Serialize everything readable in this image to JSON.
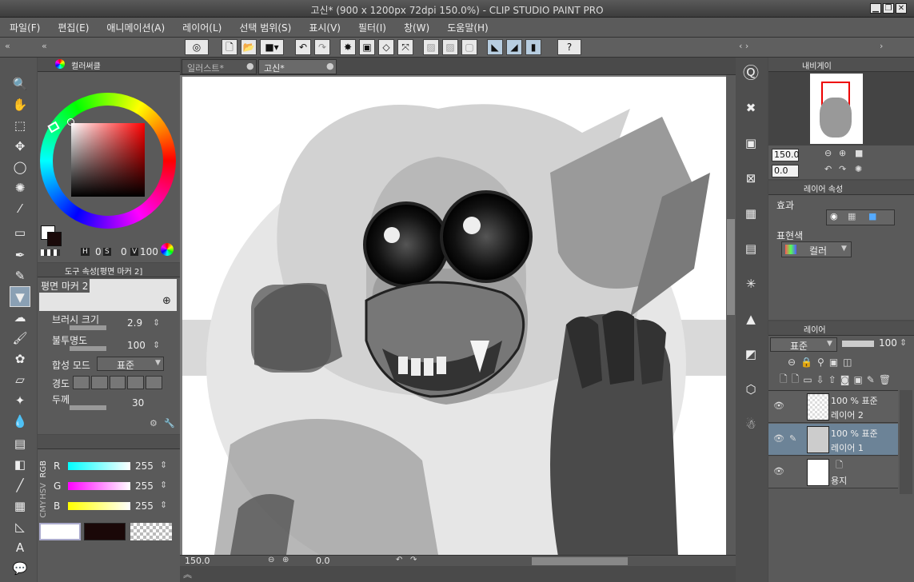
{
  "window": {
    "title": "고신* (900 x 1200px 72dpi 150.0%) - CLIP STUDIO PAINT PRO"
  },
  "menu": [
    "파일(F)",
    "편집(E)",
    "애니메이션(A)",
    "레이어(L)",
    "선택 범위(S)",
    "표시(V)",
    "필터(I)",
    "창(W)",
    "도움말(H)"
  ],
  "tabs": [
    "일러스트*",
    "고신*"
  ],
  "color_wheel": {
    "tab": "컬러써클",
    "h_label": "H",
    "h": "0",
    "s_label": "S",
    "s": "0",
    "v_label": "V",
    "v": "100"
  },
  "tool_property": {
    "tab": "도구 속성[평면 마커 2]",
    "brush": "평면 마커 2",
    "rows": [
      {
        "label": "브러시 크기",
        "value": "2.9"
      },
      {
        "label": "불투명도",
        "value": "100"
      },
      {
        "label": "합성 모드",
        "value": "표준"
      },
      {
        "label": "경도",
        "value": ""
      },
      {
        "label": "두께",
        "value": "30"
      }
    ]
  },
  "color_slider": {
    "mode_labels": [
      "RGB",
      "HSV",
      "CMY"
    ],
    "r_label": "R",
    "r": "255",
    "g_label": "G",
    "g": "255",
    "b_label": "B",
    "b": "255"
  },
  "status": {
    "zoom": "150.0",
    "angle": "0.0"
  },
  "navigator": {
    "tab": "내비게이",
    "zoom": "150.0",
    "angle": "0.0"
  },
  "layer_property": {
    "tab": "레이어 속성",
    "effect_label": "효과",
    "expression_label": "표현색",
    "expression_value": "컬러"
  },
  "layers_panel": {
    "tab": "레이어",
    "blend": "표준",
    "opacity": "100",
    "layers": [
      {
        "opacity_mode": "100 % 표준",
        "name": "레이어 2",
        "selected": false
      },
      {
        "opacity_mode": "100 % 표준",
        "name": "레이어 1",
        "selected": true
      },
      {
        "opacity_mode": "",
        "name": "용지",
        "selected": false
      }
    ]
  },
  "colors": {
    "accent": "#6c8397",
    "panel": "#5a5a5a",
    "canvas_bg": "#ffffff"
  }
}
